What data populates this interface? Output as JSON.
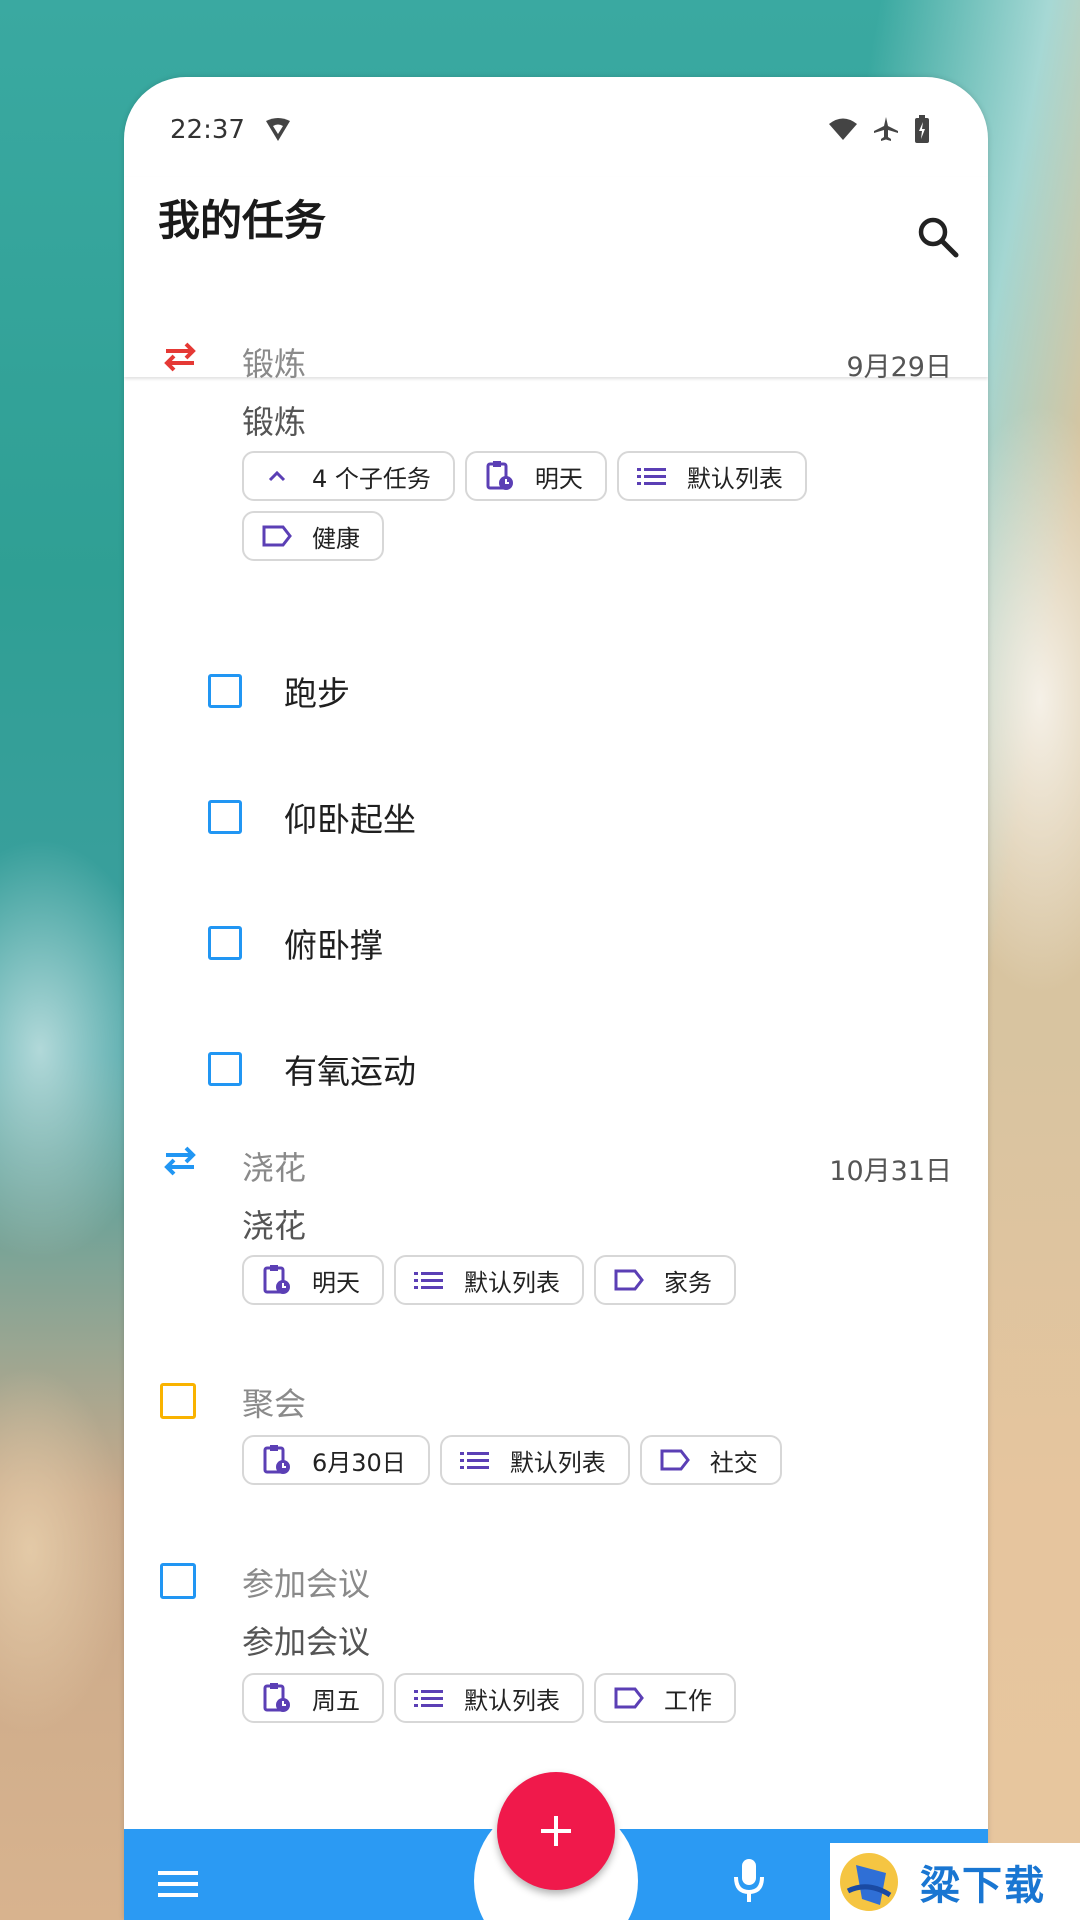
{
  "status": {
    "time": "22:37"
  },
  "app": {
    "title": "我的任务"
  },
  "tasks": [
    {
      "title": "锻炼",
      "date": "9月29日",
      "note": "锻炼",
      "icon": "repeat-icon",
      "icon_color": "#e53935",
      "chips": {
        "subtasks": "4 个子任务",
        "due": "明天",
        "list": "默认列表",
        "tag": "健康"
      },
      "subtasks": [
        "跑步",
        "仰卧起坐",
        "俯卧撑",
        "有氧运动"
      ]
    },
    {
      "title": "浇花",
      "date": "10月31日",
      "note": "浇花",
      "icon": "repeat-icon",
      "icon_color": "#2196f3",
      "chips": {
        "due": "明天",
        "list": "默认列表",
        "tag": "家务"
      }
    },
    {
      "title": "聚会",
      "icon": "checkbox-icon",
      "icon_color": "#f9b300",
      "chips": {
        "due": "6月30日",
        "list": "默认列表",
        "tag": "社交"
      }
    },
    {
      "title": "参加会议",
      "note": "参加会议",
      "icon": "checkbox-icon",
      "icon_color": "#2196f3",
      "chips": {
        "due": "周五",
        "list": "默认列表",
        "tag": "工作"
      }
    }
  ],
  "watermark": {
    "text": "粱下载"
  },
  "colors": {
    "accent": "#2b9af3",
    "fab": "#f0194b",
    "chip_icon": "#5b3fb5"
  }
}
